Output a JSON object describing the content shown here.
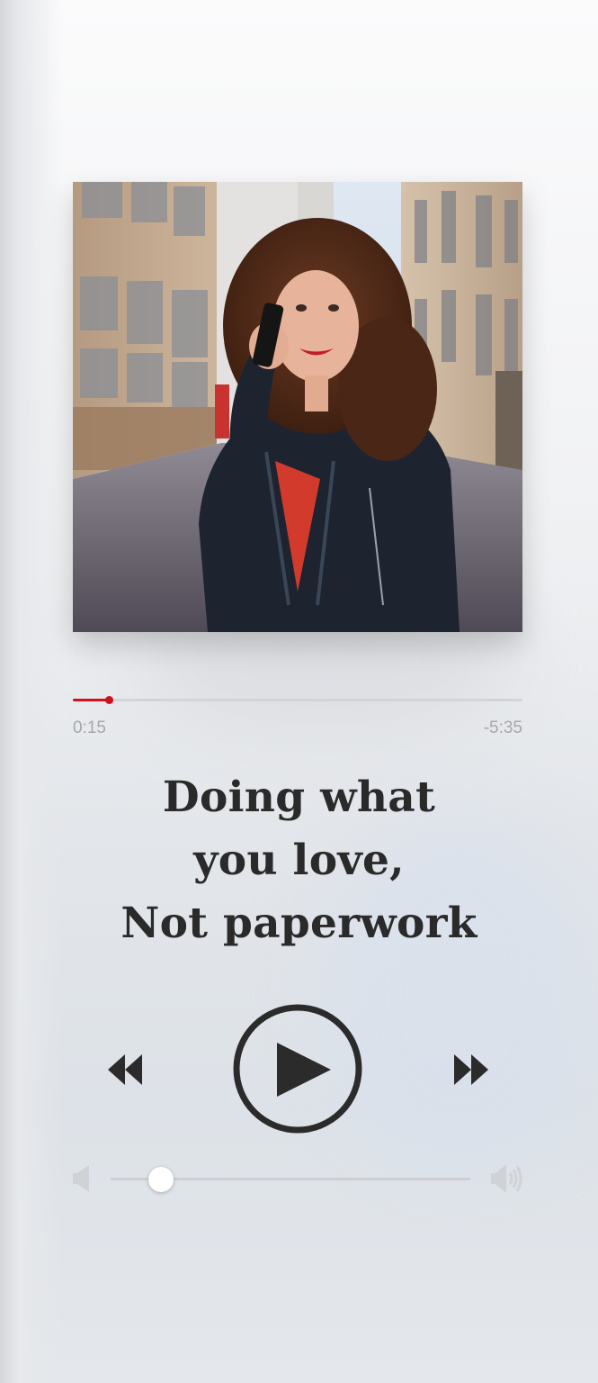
{
  "player": {
    "album_art": {
      "alt": "Woman with curly hair smiling while on the phone in a city alley"
    },
    "progress": {
      "fraction": 0.08,
      "elapsed": "0:15",
      "remaining": "-5:35",
      "accent_color": "#d0101a"
    },
    "title_lines": [
      "Doing what",
      "you love,",
      "Not paperwork"
    ],
    "controls": {
      "rewind_icon": "rewind-icon",
      "play_icon": "play-icon",
      "forward_icon": "fast-forward-icon"
    },
    "volume": {
      "fraction": 0.14,
      "min_icon": "volume-low-icon",
      "max_icon": "volume-high-icon"
    }
  }
}
